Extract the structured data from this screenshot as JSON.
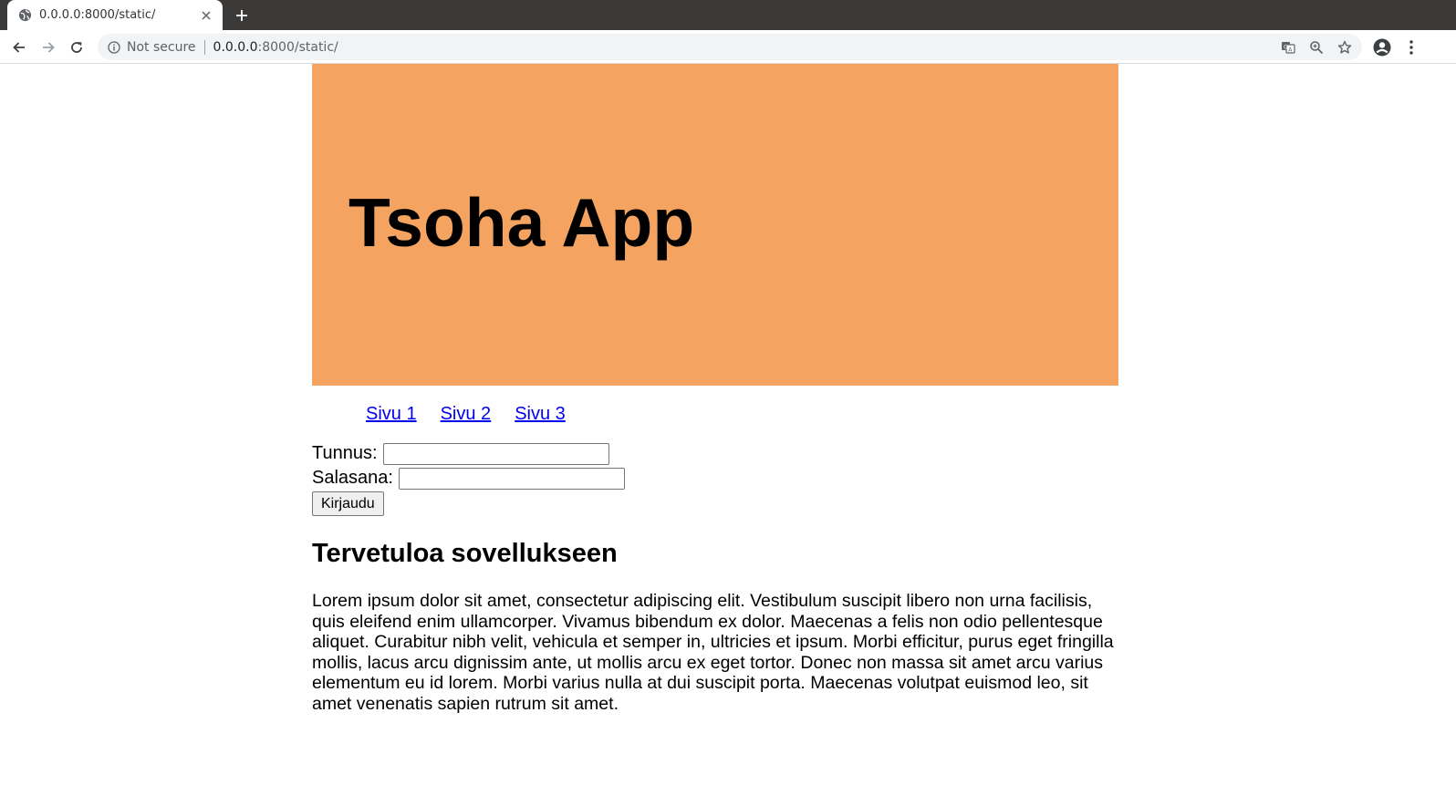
{
  "browser": {
    "tab": {
      "title": "0.0.0.0:8000/static/"
    },
    "omnibox": {
      "security_label": "Not secure",
      "url_host": "0.0.0.0",
      "url_rest": ":8000/static/"
    },
    "colors": {
      "tabstrip": "#3b3a38",
      "omnibox_bg": "#f1f3f4"
    }
  },
  "page": {
    "hero": {
      "title": "Tsoha App",
      "background": "#f4a460"
    },
    "nav": [
      {
        "label": "Sivu 1"
      },
      {
        "label": "Sivu 2"
      },
      {
        "label": "Sivu 3"
      }
    ],
    "login": {
      "username_label": "Tunnus:",
      "username_value": "",
      "password_label": "Salasana:",
      "password_value": "",
      "submit_label": "Kirjaudu"
    },
    "welcome_heading": "Tervetuloa sovellukseen",
    "body_text": "Lorem ipsum dolor sit amet, consectetur adipiscing elit. Vestibulum suscipit libero non urna facilisis, quis eleifend enim ullamcorper. Vivamus bibendum ex dolor. Maecenas a felis non odio pellentesque aliquet. Curabitur nibh velit, vehicula et semper in, ultricies et ipsum. Morbi efficitur, purus eget fringilla mollis, lacus arcu dignissim ante, ut mollis arcu ex eget tortor. Donec non massa sit amet arcu varius elementum eu id lorem. Morbi varius nulla at dui suscipit porta. Maecenas volutpat euismod leo, sit amet venenatis sapien rutrum sit amet."
  }
}
